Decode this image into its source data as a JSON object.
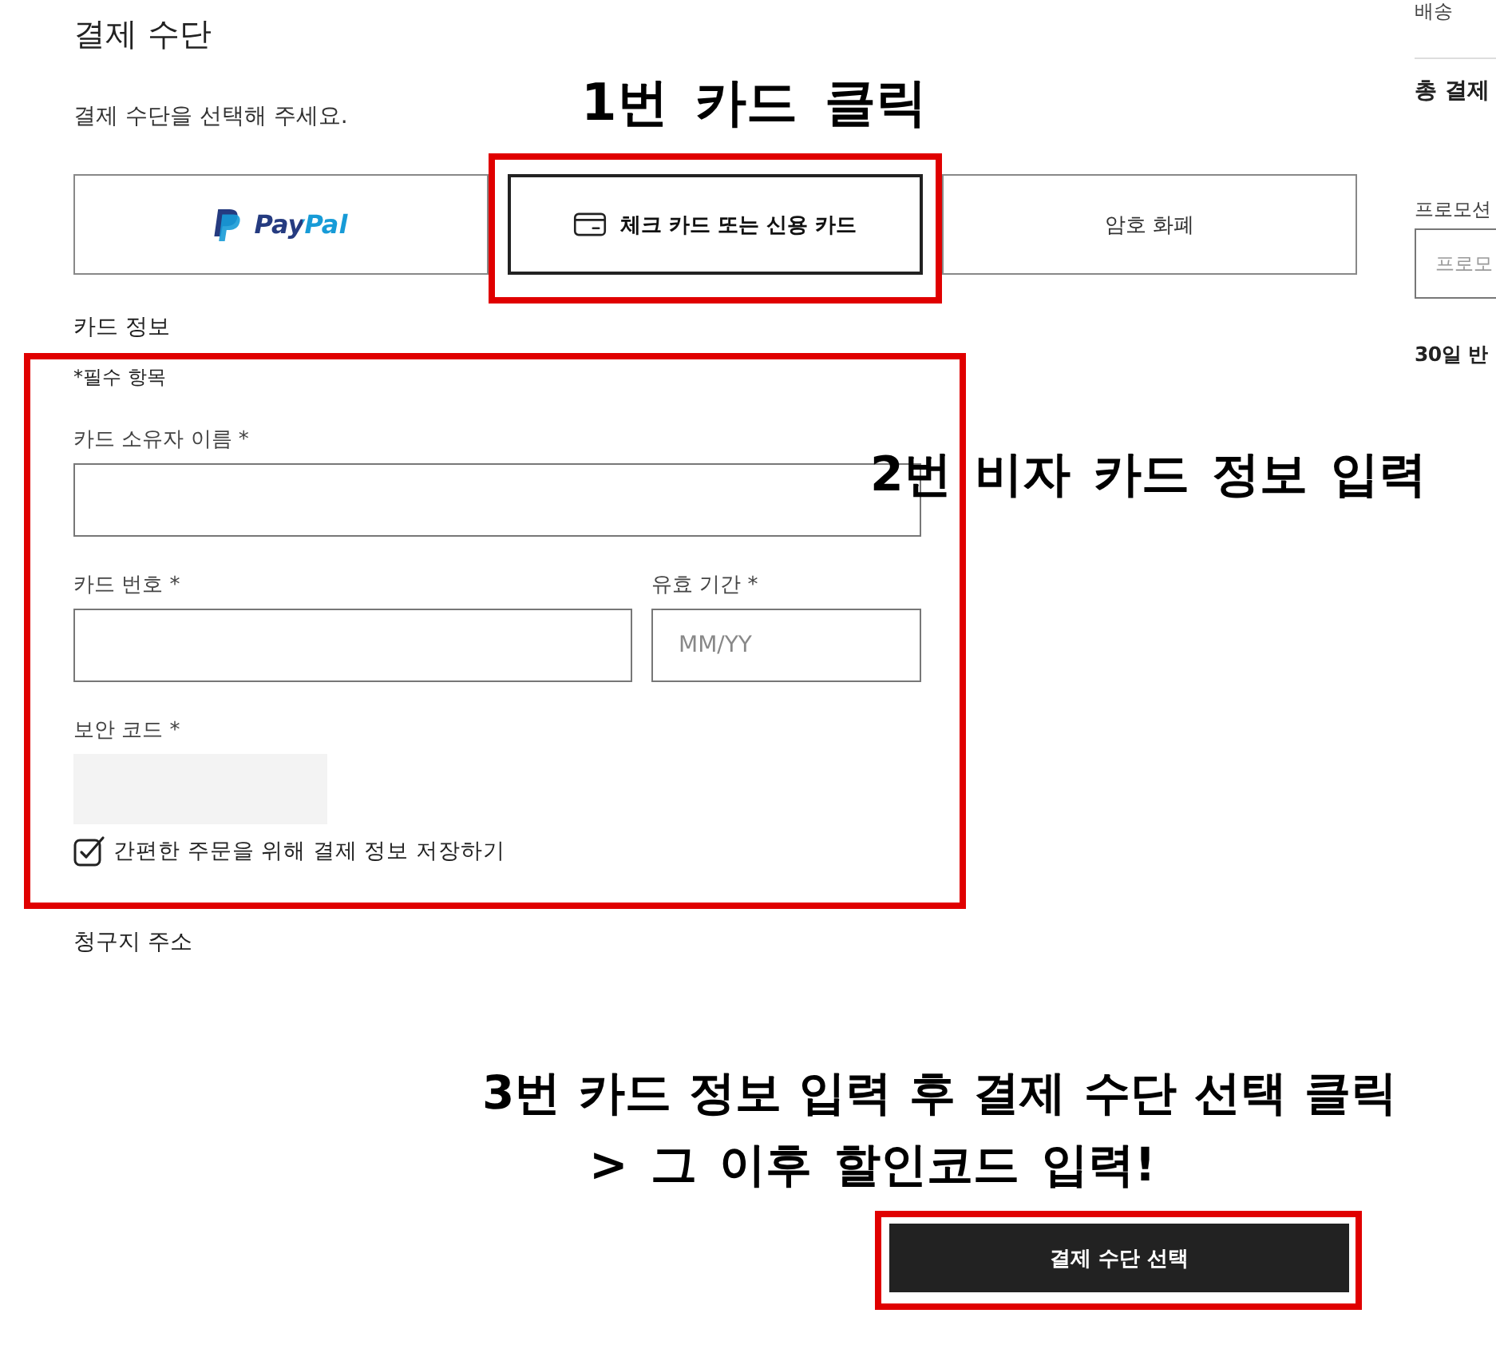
{
  "section": {
    "title": "결제 수단",
    "prompt": "결제 수단을 선택해 주세요."
  },
  "payment_methods": [
    {
      "kind": "logo",
      "label": "PayPal",
      "selected": false
    },
    {
      "kind": "icon",
      "label": "체크 카드 또는 신용 카드",
      "selected": true
    },
    {
      "kind": "plain",
      "label": "암호 화폐",
      "selected": false
    }
  ],
  "card_info": {
    "title": "카드 정보",
    "required_note": "*필수 항목",
    "fields": [
      {
        "kind": "text",
        "label": "카드 소유자 이름 *"
      },
      {
        "kind": "text",
        "label": "카드 번호 *"
      },
      {
        "kind": "text",
        "label": "유효 기간 *",
        "placeholder": "MM/YY"
      },
      {
        "kind": "secure",
        "label": "보안 코드 *"
      }
    ],
    "save_option": {
      "label": "간편한 주문을 위해 결제 정보 저장하기",
      "checked": true
    }
  },
  "billing_address": {
    "title": "청구지 주소"
  },
  "submit_button": {
    "label": "결제 수단 선택"
  },
  "summary": {
    "shipping_label": "배송",
    "total_label": "총 결제",
    "promo_label": "프로모션",
    "promo_placeholder": "프로모",
    "return_policy": "30일 반"
  },
  "annotations": [
    {
      "lines": [
        "1번 카드 클릭"
      ]
    },
    {
      "lines": [
        "2번 비자 카드 정보 입력"
      ]
    },
    {
      "lines": [
        "3번 카드 정보 입력 후 결제 수단 선택 클릭",
        "> 그 이후 할인코드 입력!"
      ]
    }
  ]
}
